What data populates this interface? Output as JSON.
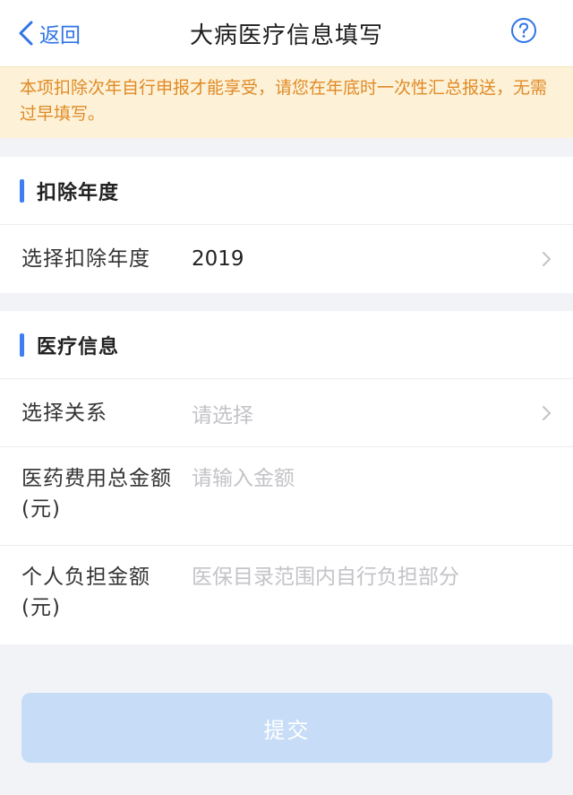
{
  "nav": {
    "back_label": "返回",
    "title": "大病医疗信息填写"
  },
  "notice": {
    "text": "本项扣除次年自行申报才能享受，请您在年底时一次性汇总报送，无需过早填写。"
  },
  "section_year": {
    "title": "扣除年度",
    "row_label": "选择扣除年度",
    "row_value": "2019"
  },
  "section_medical": {
    "title": "医疗信息",
    "relation_label": "选择关系",
    "relation_placeholder": "请选择",
    "total_label": "医药费用总金额(元)",
    "total_placeholder": "请输入金额",
    "personal_label": "个人负担金额(元)",
    "personal_placeholder": "医保目录范围内自行负担部分"
  },
  "submit": {
    "label": "提交"
  },
  "colors": {
    "accent": "#2f74e6",
    "notice_bg": "#fdf2d8",
    "notice_text": "#e08a26",
    "submit_disabled": "#c6dcf7"
  }
}
